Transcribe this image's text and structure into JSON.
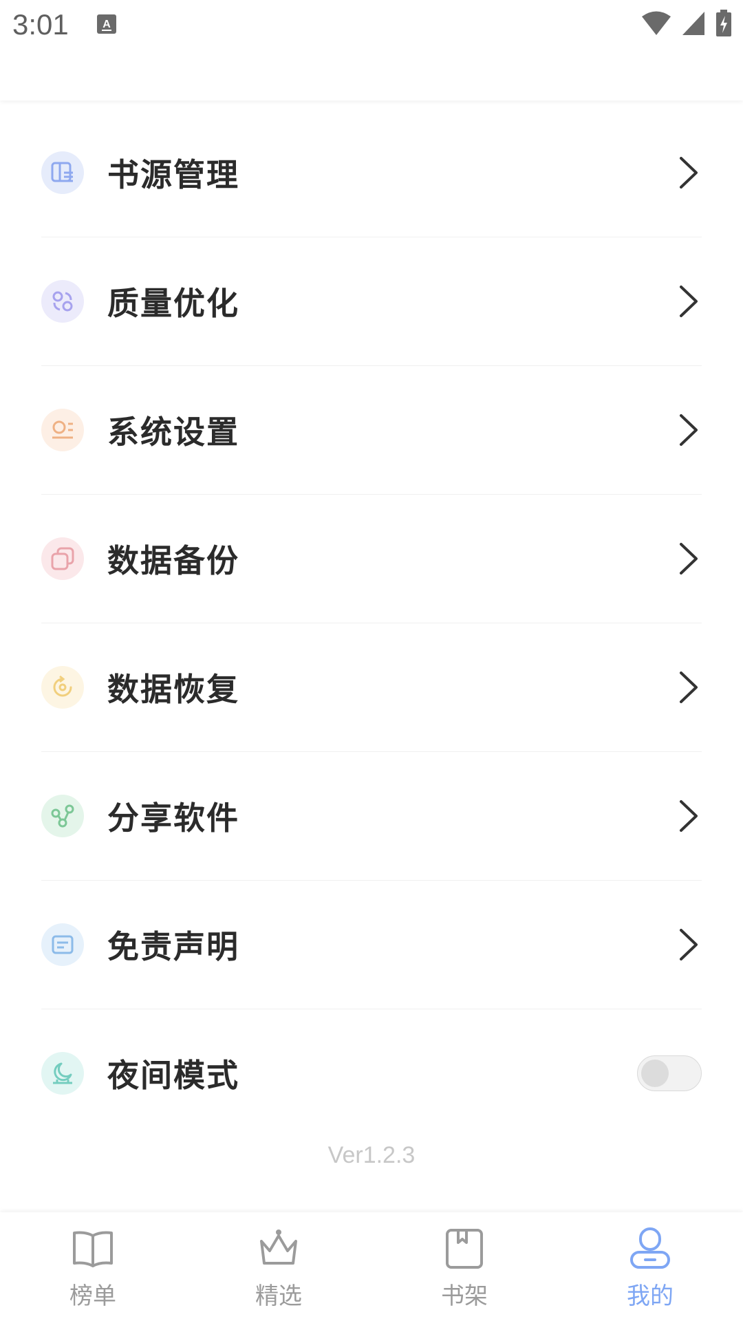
{
  "status_bar": {
    "time": "3:01",
    "icons": [
      "keyboard-a-icon",
      "wifi-icon",
      "signal-icon",
      "battery-charging-icon"
    ]
  },
  "menu": {
    "items": [
      {
        "label": "书源管理",
        "icon": "book-source-icon",
        "icon_bg": "#e6ecfb",
        "icon_color": "#8ea8ef",
        "trailing": "chevron"
      },
      {
        "label": "质量优化",
        "icon": "optimize-icon",
        "icon_bg": "#ecebfb",
        "icon_color": "#a7a2ee",
        "trailing": "chevron"
      },
      {
        "label": "系统设置",
        "icon": "settings-icon",
        "icon_bg": "#fdefe5",
        "icon_color": "#efb184",
        "trailing": "chevron"
      },
      {
        "label": "数据备份",
        "icon": "backup-icon",
        "icon_bg": "#fbe8ea",
        "icon_color": "#e9a3aa",
        "trailing": "chevron"
      },
      {
        "label": "数据恢复",
        "icon": "restore-icon",
        "icon_bg": "#fdf5e3",
        "icon_color": "#f1cf7d",
        "trailing": "chevron"
      },
      {
        "label": "分享软件",
        "icon": "share-icon",
        "icon_bg": "#e4f5ea",
        "icon_color": "#7cc796",
        "trailing": "chevron"
      },
      {
        "label": "免责声明",
        "icon": "disclaimer-icon",
        "icon_bg": "#e6f1fb",
        "icon_color": "#8cbbe9",
        "trailing": "chevron"
      },
      {
        "label": "夜间模式",
        "icon": "night-mode-icon",
        "icon_bg": "#e2f6f3",
        "icon_color": "#74cdbf",
        "trailing": "toggle",
        "toggle_on": false
      }
    ]
  },
  "version": "Ver1.2.3",
  "bottom_nav": {
    "items": [
      {
        "label": "榜单",
        "icon": "open-book-icon",
        "active": false
      },
      {
        "label": "精选",
        "icon": "crown-icon",
        "active": false
      },
      {
        "label": "书架",
        "icon": "bookshelf-icon",
        "active": false
      },
      {
        "label": "我的",
        "icon": "profile-icon",
        "active": true
      }
    ],
    "active_color": "#7ea6f4",
    "inactive_color": "#9b9b9b"
  }
}
